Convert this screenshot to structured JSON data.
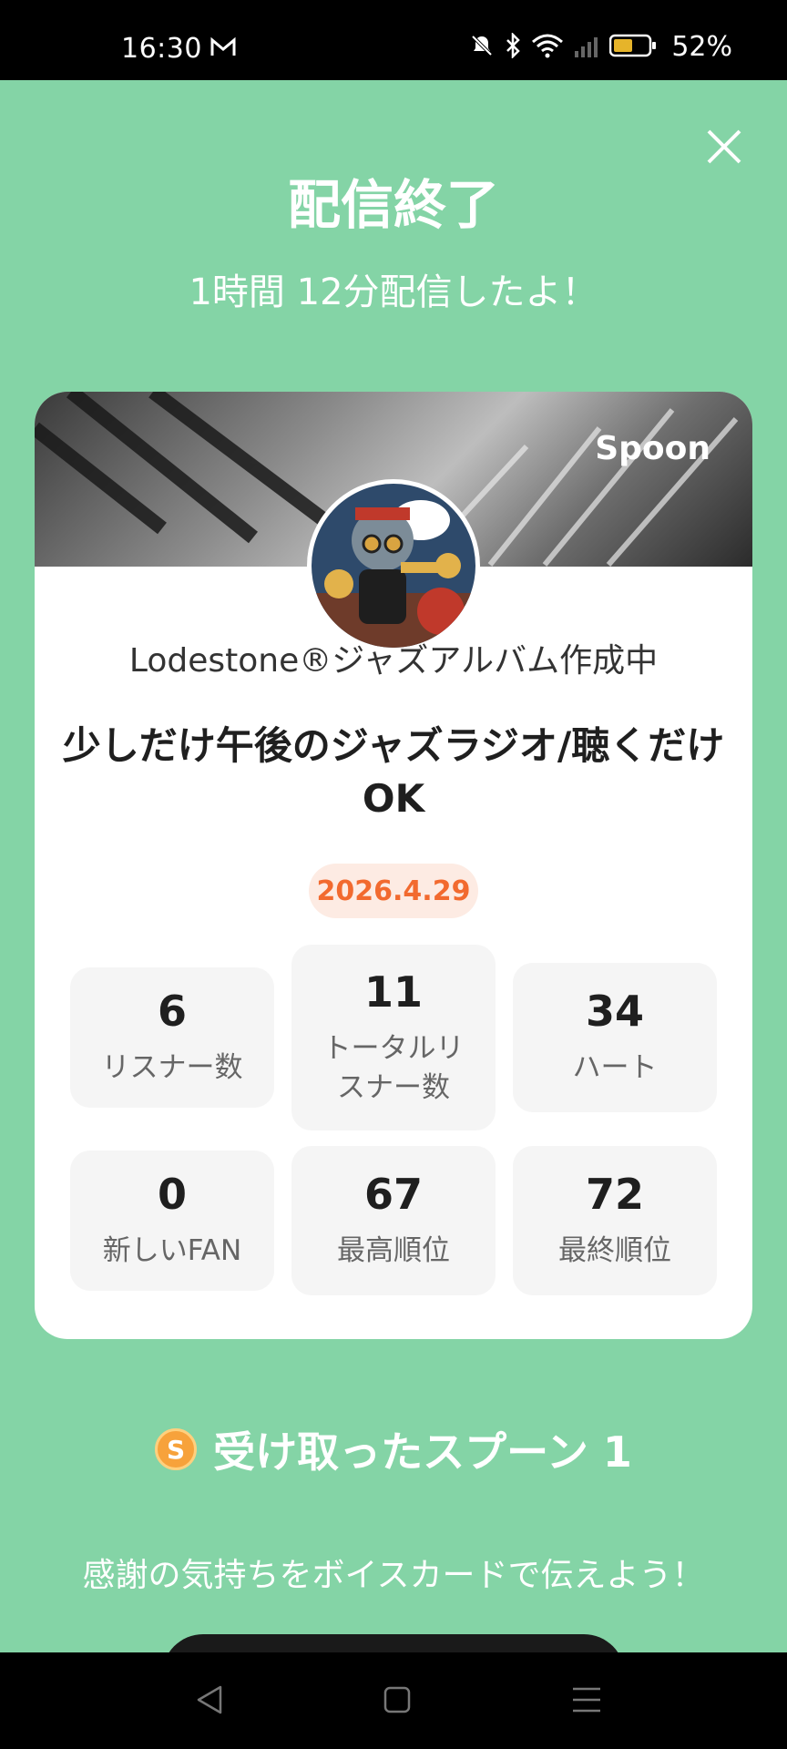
{
  "status": {
    "time": "16:30",
    "battery": "52%"
  },
  "header": {
    "title": "配信終了",
    "subtitle": "1時間 12分配信したよ！"
  },
  "card": {
    "brand": "Spoon",
    "host_name": "Lodestone®ジャズアルバム作成中",
    "live_title": "少しだけ午後のジャズラジオ/聴くだけOK",
    "date": "2026.4.29",
    "stats": [
      {
        "value": "6",
        "label": "リスナー数"
      },
      {
        "value": "11",
        "label": "トータルリスナー数"
      },
      {
        "value": "34",
        "label": "ハート"
      },
      {
        "value": "0",
        "label": "新しいFAN"
      },
      {
        "value": "67",
        "label": "最高順位"
      },
      {
        "value": "72",
        "label": "最終順位"
      }
    ]
  },
  "spoons": {
    "coin_letter": "S",
    "label": "受け取ったスプーン 1"
  },
  "thanks": "感謝の気持ちをボイスカードで伝えよう！",
  "colors": {
    "background": "#84d4a6",
    "date_text": "#f26a2f",
    "date_bg": "#fdebe3",
    "coin": "#f7a23b"
  },
  "icons": [
    "mail-icon",
    "mute-icon",
    "bluetooth-icon",
    "wifi-icon",
    "signal-icon",
    "battery-icon",
    "close-icon",
    "back-icon",
    "home-icon",
    "recents-icon"
  ]
}
